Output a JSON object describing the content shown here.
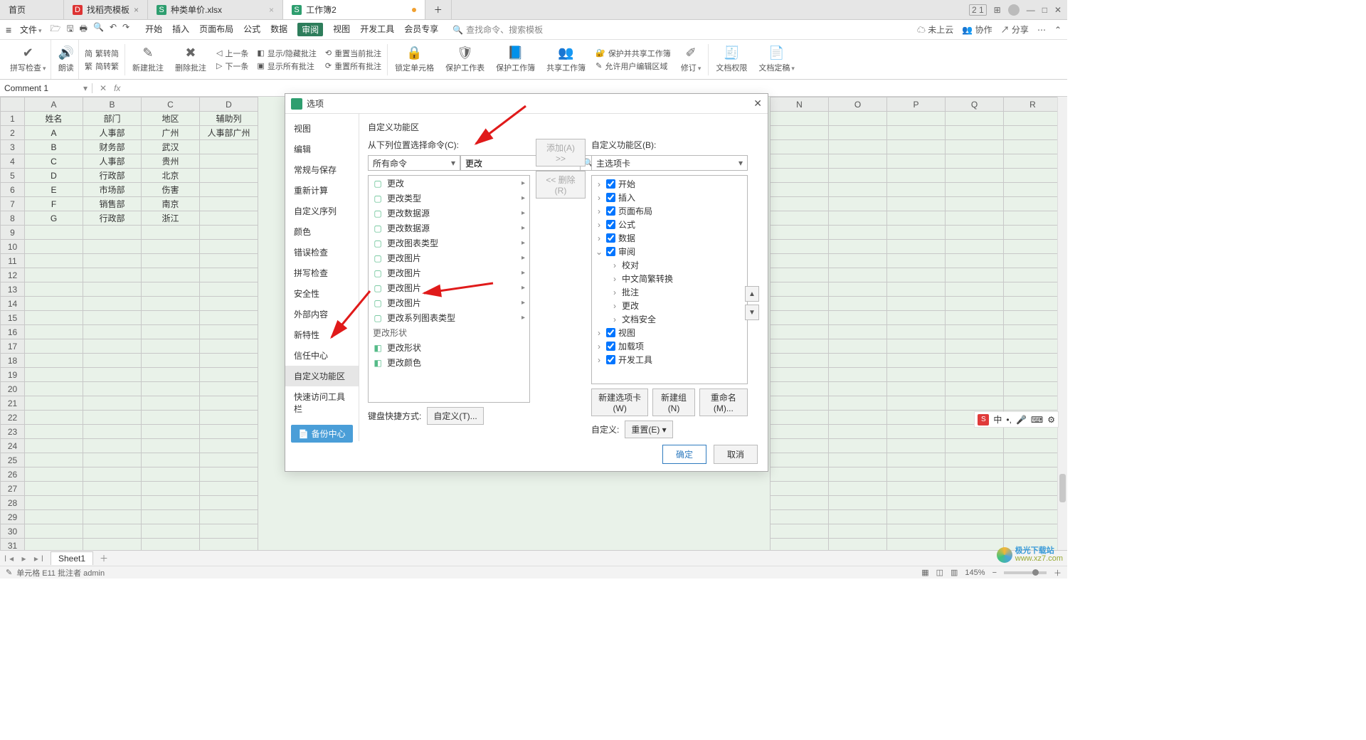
{
  "tabs": {
    "home": "首页",
    "t1": "找稻壳模板",
    "t2": "种类单价.xlsx",
    "t3": "工作簿2"
  },
  "menu": {
    "file": "文件",
    "main": [
      "开始",
      "插入",
      "页面布局",
      "公式",
      "数据",
      "审阅",
      "视图",
      "开发工具",
      "会员专享"
    ],
    "active": "审阅",
    "search1": "查找命令、搜索模板",
    "right": {
      "cloud": "未上云",
      "coop": "协作",
      "share": "分享"
    }
  },
  "ribbon": {
    "spell": "拼写检查",
    "read": "朗读",
    "s2t": "繁转简",
    "t2s": "简转繁",
    "newc": "新建批注",
    "delc": "删除批注",
    "prev": "上一条",
    "next": "下一条",
    "show": "显示/隐藏批注",
    "showall": "显示所有批注",
    "resetcur": "重置当前批注",
    "resetall": "重置所有批注",
    "lock": "锁定单元格",
    "protectsheet": "保护工作表",
    "protectbook": "保护工作簿",
    "sharebook": "共享工作簿",
    "protshare": "保护并共享工作簿",
    "allowedit": "允许用户编辑区域",
    "track": "修订",
    "docperm": "文档权限",
    "docfix": "文档定稿"
  },
  "namebox": "Comment 1",
  "fx": "fx",
  "sheet": {
    "cols": [
      "A",
      "B",
      "C",
      "D",
      "N",
      "O",
      "P",
      "Q",
      "R"
    ],
    "head": [
      "姓名",
      "部门",
      "地区",
      "辅助列"
    ],
    "rows": [
      [
        "A",
        "人事部",
        "广州",
        "人事部广州"
      ],
      [
        "B",
        "财务部",
        "武汉",
        ""
      ],
      [
        "C",
        "人事部",
        "贵州",
        ""
      ],
      [
        "D",
        "行政部",
        "北京",
        ""
      ],
      [
        "E",
        "市场部",
        "伤害",
        ""
      ],
      [
        "F",
        "销售部",
        "南京",
        ""
      ],
      [
        "G",
        "行政部",
        "浙江",
        ""
      ]
    ]
  },
  "dialog": {
    "title": "选项",
    "side": [
      "视图",
      "编辑",
      "常规与保存",
      "重新计算",
      "自定义序列",
      "颜色",
      "错误检查",
      "拼写检查",
      "安全性",
      "外部内容",
      "新特性",
      "信任中心",
      "自定义功能区",
      "快速访问工具栏"
    ],
    "side_selected": "自定义功能区",
    "backup": "备份中心",
    "section_left_title": "自定义功能区",
    "label_left": "从下列位置选择命令(C):",
    "combo_left": "所有命令",
    "search_value": "更改",
    "list_left": [
      "更改",
      "更改类型",
      "更改数据源",
      "更改数据源",
      "更改图表类型",
      "更改图片",
      "更改图片",
      "更改图片",
      "更改图片",
      "更改系列图表类型"
    ],
    "group_left": "更改形状",
    "group_items": [
      "更改形状",
      "更改颜色"
    ],
    "label_right": "自定义功能区(B):",
    "combo_right": "主选项卡",
    "tree": [
      "开始",
      "插入",
      "页面布局",
      "公式",
      "数据",
      "审阅",
      "视图",
      "加载项",
      "开发工具"
    ],
    "tree_expanded_children": [
      "校对",
      "中文简繁转换",
      "批注",
      "更改",
      "文档安全"
    ],
    "expanded_node": "审阅",
    "btn_add": "添加(A) >>",
    "btn_del": "<< 删除(R)",
    "new_tab": "新建选项卡(W)",
    "new_group": "新建组(N)",
    "rename": "重命名(M)...",
    "kb_label": "键盘快捷方式:",
    "custom_btn": "自定义(T)...",
    "cust_label": "自定义:",
    "reset_btn": "重置(E)",
    "ok": "确定",
    "cancel": "取消"
  },
  "sheet_tab": "Sheet1",
  "status": "单元格 E11 批注者 admin",
  "zoom": "145%",
  "ime": {
    "label": "中"
  },
  "watermark": "极光下载站",
  "watermark_url": "www.xz7.com"
}
